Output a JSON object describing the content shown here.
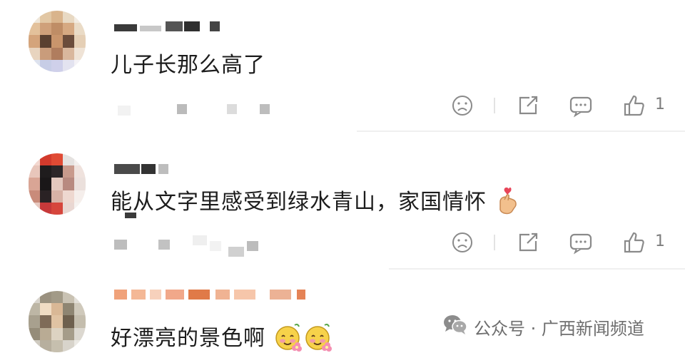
{
  "comments": [
    {
      "text": "儿子长那么高了",
      "likes": "1"
    },
    {
      "text": "能从文字里感受到绿水青山，家国情怀",
      "likes": "1",
      "emoji": "finger-heart"
    },
    {
      "text": "好漂亮的景色啊",
      "emoji": "flower-blush-pair"
    }
  ],
  "actions": {
    "dislike_icon": "frown-face-icon",
    "share_icon": "share-arrow-icon",
    "reply_icon": "comment-bubble-icon",
    "like_icon": "thumbs-up-icon"
  },
  "watermark": {
    "icon": "wechat-icon",
    "text": "公众号 · 广西新闻频道"
  },
  "colors": {
    "text": "#1c1c1c",
    "muted": "#7d7d7d",
    "icon": "#8a8a8a"
  }
}
